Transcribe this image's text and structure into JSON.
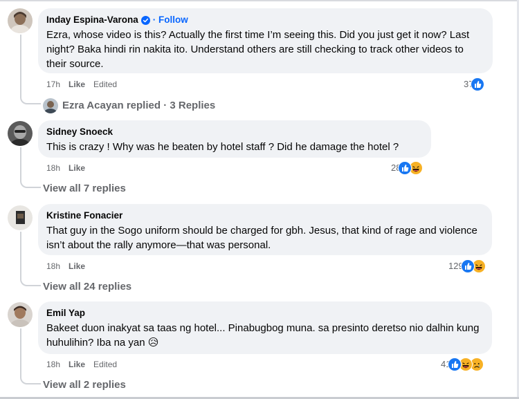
{
  "comments": [
    {
      "author": "Inday Espina-Varona",
      "follow": "· Follow",
      "text": "Ezra, whose video is this? Actually the first time I’m seeing this. Did you just get it now? Last night? Baka hindi rin nakita ito. Understand others are still checking to track other videos to their source.",
      "time": "17h",
      "like": "Like",
      "edited": "Edited",
      "reactions": "37",
      "replies_author": "Ezra Acayan",
      "replies_text": " replied · 3 Replies"
    },
    {
      "author": "Sidney Snoeck",
      "text": "This is crazy ! Why was he beaten by hotel staff ? Did he damage the hotel ?",
      "time": "18h",
      "like": "Like",
      "reactions": "28",
      "view_all": "View all 7 replies"
    },
    {
      "author": "Kristine Fonacier",
      "text": "That guy in the Sogo uniform should be charged for gbh. Jesus, that kind of rage and violence isn’t about the rally anymore—that was personal.",
      "time": "18h",
      "like": "Like",
      "reactions": "129",
      "view_all": "View all 24 replies"
    },
    {
      "author": "Emil Yap",
      "text": "Bakeet duon inakyat sa taas ng hotel... Pinabugbog muna. sa presinto deretso nio dalhin kung huhulihin? Iba na yan",
      "emoji": "😥",
      "time": "18h",
      "like": "Like",
      "edited": "Edited",
      "reactions": "41",
      "view_all": "View all 2 replies"
    }
  ],
  "colors": {
    "like_blue": "#1877f2",
    "haha_yellow": "#f7b125",
    "link_blue": "#0866ff",
    "bubble_bg": "#f0f2f5",
    "meta_gray": "#65676b"
  },
  "icons": [
    "verified-badge-icon",
    "like-reaction-icon",
    "haha-reaction-icon",
    "sad-reaction-icon",
    "sad-emoji-icon"
  ]
}
